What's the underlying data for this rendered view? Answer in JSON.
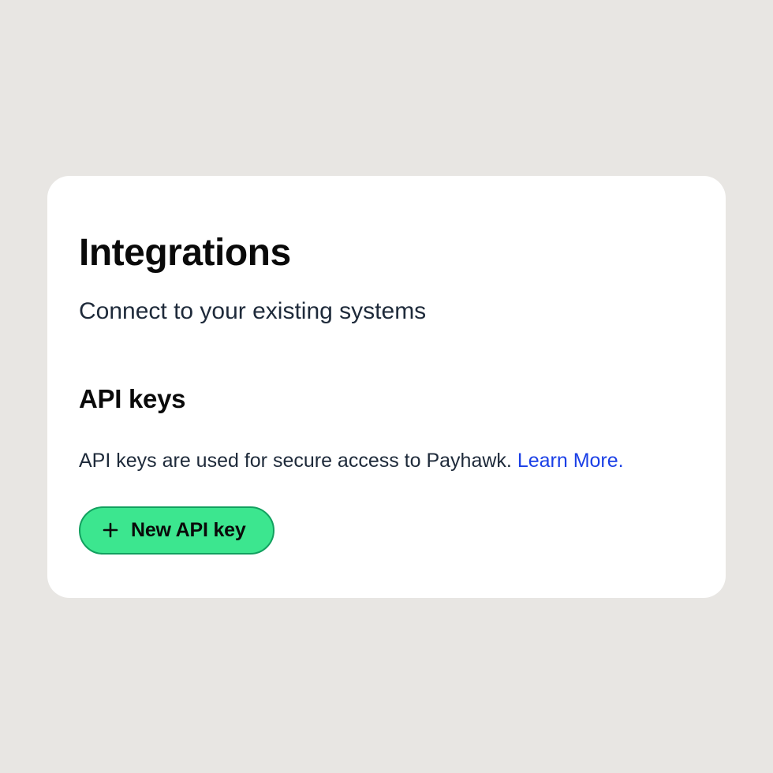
{
  "header": {
    "title": "Integrations",
    "subtitle": "Connect to your existing systems"
  },
  "api_keys_section": {
    "heading": "API keys",
    "description": "API keys are used for secure access to Payhawk. ",
    "learn_more_label": "Learn More."
  },
  "new_api_key_button": {
    "label": "New API key"
  },
  "colors": {
    "accent": "#3ce68f",
    "link": "#1a3fe6",
    "background": "#e8e6e3",
    "card": "#ffffff"
  }
}
